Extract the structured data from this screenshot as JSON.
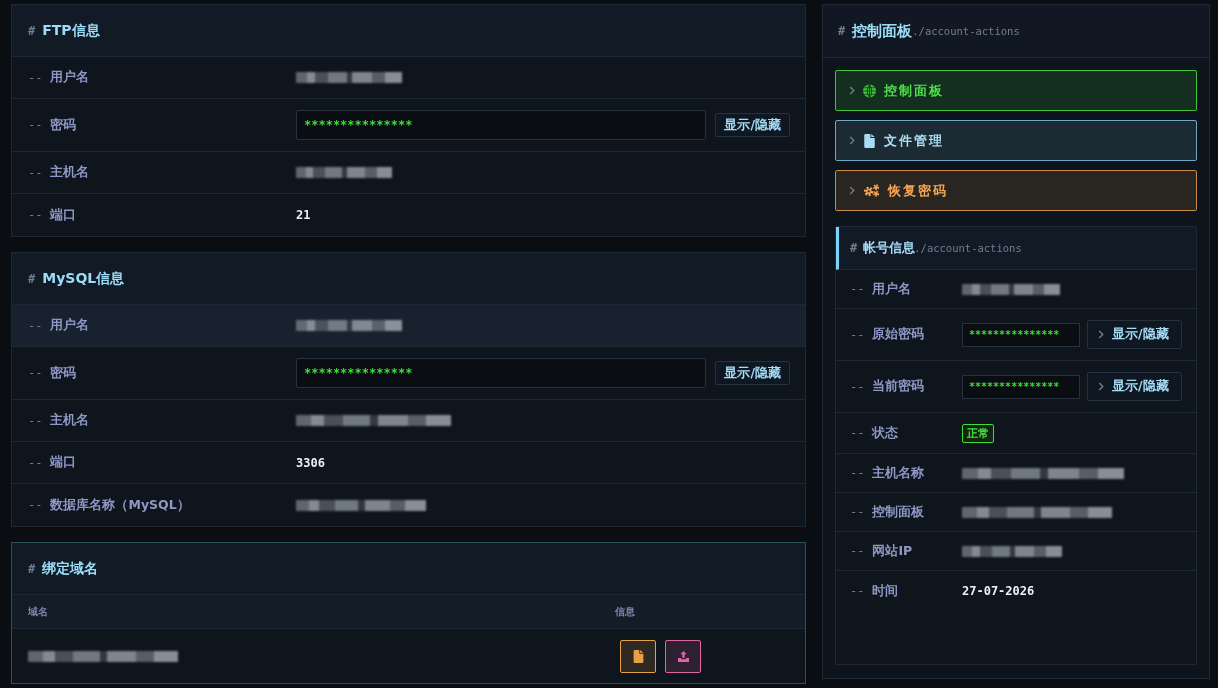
{
  "ftp": {
    "prefix": "#",
    "title": "FTP信息",
    "rows": [
      {
        "prefix": "--",
        "label": "用户名",
        "kind": "text",
        "redacted": true
      },
      {
        "prefix": "--",
        "label": "密码",
        "kind": "password",
        "value": "***************",
        "button": "显示/隐藏"
      },
      {
        "prefix": "--",
        "label": "主机名",
        "kind": "text",
        "redacted": true
      },
      {
        "prefix": "--",
        "label": "端口",
        "kind": "text",
        "redacted": false,
        "value": "21"
      }
    ]
  },
  "mysql": {
    "prefix": "#",
    "title": "MySQL信息",
    "rows": [
      {
        "prefix": "--",
        "label": "用户名",
        "kind": "text",
        "redacted": true,
        "highlighted": true
      },
      {
        "prefix": "--",
        "label": "密码",
        "kind": "password",
        "value": "***************",
        "button": "显示/隐藏",
        "highlighted": false
      },
      {
        "prefix": "--",
        "label": "主机名",
        "kind": "text",
        "redacted": true,
        "highlighted": false
      },
      {
        "prefix": "--",
        "label": "端口",
        "kind": "text",
        "redacted": false,
        "value": "3306",
        "highlighted": false
      },
      {
        "prefix": "--",
        "label": "数据库名称（MySQL）",
        "kind": "text",
        "redacted": true,
        "highlighted": false
      }
    ]
  },
  "domains": {
    "prefix": "#",
    "title": "绑定域名",
    "columns": [
      "域名",
      "信息"
    ],
    "rows": [
      {
        "redacted": true,
        "actions": [
          {
            "kind": "file",
            "color": "#e8a048"
          },
          {
            "kind": "upload",
            "color": "#e064a8"
          }
        ]
      }
    ]
  },
  "panel": {
    "prefix": "#",
    "title": "控制面板",
    "path": "./account-actions",
    "actions": [
      {
        "kind": "globe",
        "label": "控制面板",
        "color": "#3fc43a"
      },
      {
        "kind": "file",
        "label": "文件管理",
        "color": "#6fa8c4"
      },
      {
        "kind": "gears",
        "label": "恢复密码",
        "color": "#c98a4a"
      }
    ],
    "account": {
      "prefix": "#",
      "title": "帐号信息",
      "path": "./account-actions",
      "rows": [
        {
          "prefix": "--",
          "label": "用户名",
          "kind": "text",
          "redacted": true
        },
        {
          "prefix": "--",
          "label": "原始密码",
          "kind": "password",
          "value": "***************",
          "button": "显示/隐藏"
        },
        {
          "prefix": "--",
          "label": "当前密码",
          "kind": "password",
          "value": "***************",
          "button": "显示/隐藏"
        },
        {
          "prefix": "--",
          "label": "状态",
          "kind": "badge",
          "value": "正常"
        },
        {
          "prefix": "--",
          "label": "主机名称",
          "kind": "text",
          "redacted": true
        },
        {
          "prefix": "--",
          "label": "控制面板",
          "kind": "text",
          "redacted": true
        },
        {
          "prefix": "--",
          "label": "网站IP",
          "kind": "text",
          "redacted": true
        },
        {
          "prefix": "--",
          "label": "时间",
          "kind": "text",
          "redacted": false,
          "value": "27-07-2026"
        }
      ]
    }
  }
}
